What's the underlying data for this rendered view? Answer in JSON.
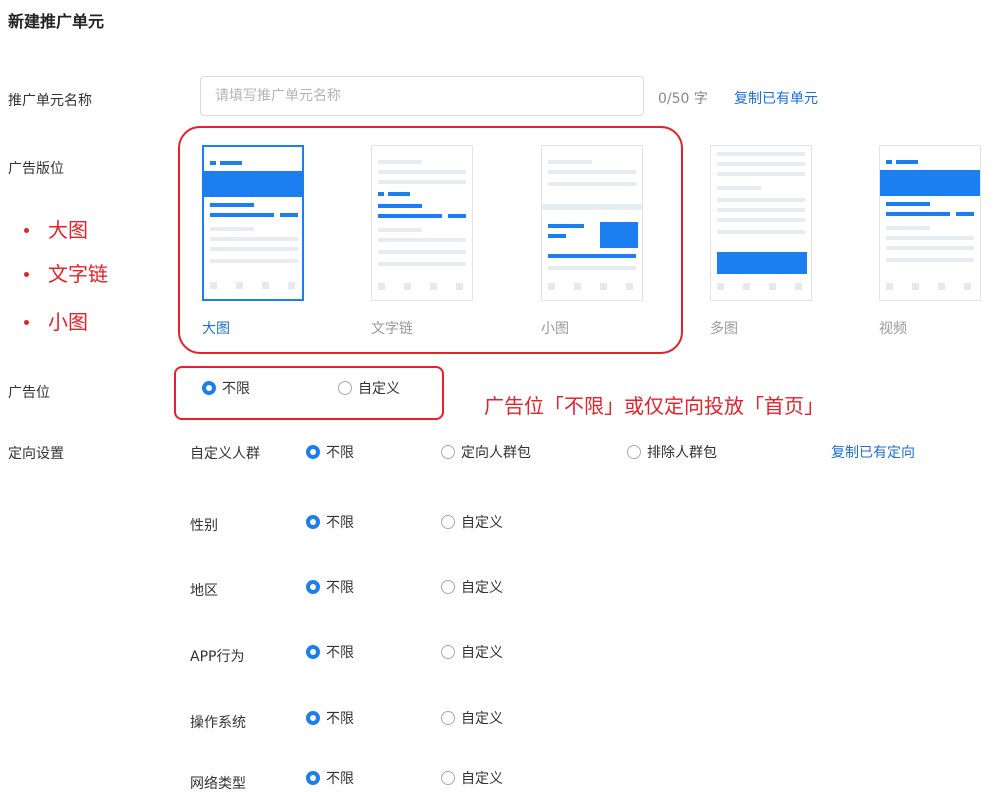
{
  "page_title": "新建推广单元",
  "unit_name": {
    "label": "推广单元名称",
    "placeholder": "请填写推广单元名称",
    "counter": "0/50 字",
    "copy_link": "复制已有单元"
  },
  "ad_format": {
    "label": "广告版位",
    "options": [
      "大图",
      "文字链",
      "小图",
      "多图",
      "视频"
    ],
    "selected": "大图"
  },
  "annotation_left": [
    "大图",
    "文字链",
    "小图"
  ],
  "ad_position": {
    "label": "广告位",
    "options": [
      "不限",
      "自定义"
    ],
    "selected": "不限",
    "annotation": "广告位「不限」或仅定向投放「首页」"
  },
  "targeting": {
    "label": "定向设置",
    "copy_link": "复制已有定向",
    "audience": {
      "label": "自定义人群",
      "options": [
        "不限",
        "定向人群包",
        "排除人群包"
      ]
    },
    "gender": {
      "label": "性别",
      "options": [
        "不限",
        "自定义"
      ]
    },
    "region": {
      "label": "地区",
      "options": [
        "不限",
        "自定义"
      ]
    },
    "app_behavior": {
      "label": "APP行为",
      "options": [
        "不限",
        "自定义"
      ]
    },
    "os": {
      "label": "操作系统",
      "options": [
        "不限",
        "自定义"
      ]
    },
    "network": {
      "label": "网络类型",
      "options": [
        "不限",
        "自定义"
      ]
    }
  },
  "colors": {
    "accent": "#1c7ff0",
    "annotation": "#e5212b"
  }
}
